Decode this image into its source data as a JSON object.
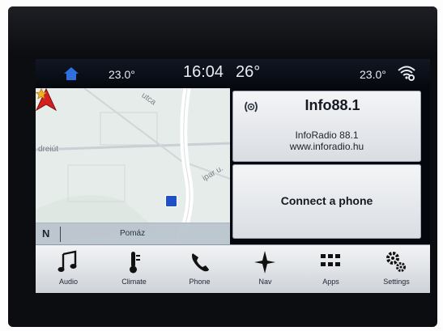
{
  "status_bar": {
    "driver_temp": "23.0°",
    "time": "16:04",
    "outside_temp": "26°",
    "passenger_temp": "23.0°",
    "home_icon": "home-icon",
    "wifi_icon": "wifi-icon"
  },
  "map": {
    "streets": [
      "dreiút",
      "ipar u.",
      "utca"
    ],
    "compass": "N",
    "city": "Pomáz",
    "colors": {
      "vehicle": "#d62020",
      "parking": "#2050c8",
      "star": "#f0b020"
    }
  },
  "radio": {
    "title": "Info88.1",
    "station": "InfoRadio 88.1",
    "url": "www.inforadio.hu",
    "icon": "radio-icon"
  },
  "phone": {
    "label": "Connect a phone"
  },
  "dock": {
    "items": [
      {
        "label": "Audio",
        "icon": "music-note-icon"
      },
      {
        "label": "Climate",
        "icon": "thermometer-icon"
      },
      {
        "label": "Phone",
        "icon": "phone-handset-icon"
      },
      {
        "label": "Nav",
        "icon": "compass-star-icon"
      },
      {
        "label": "Apps",
        "icon": "grid-icon"
      },
      {
        "label": "Settings",
        "icon": "gears-icon"
      }
    ]
  }
}
